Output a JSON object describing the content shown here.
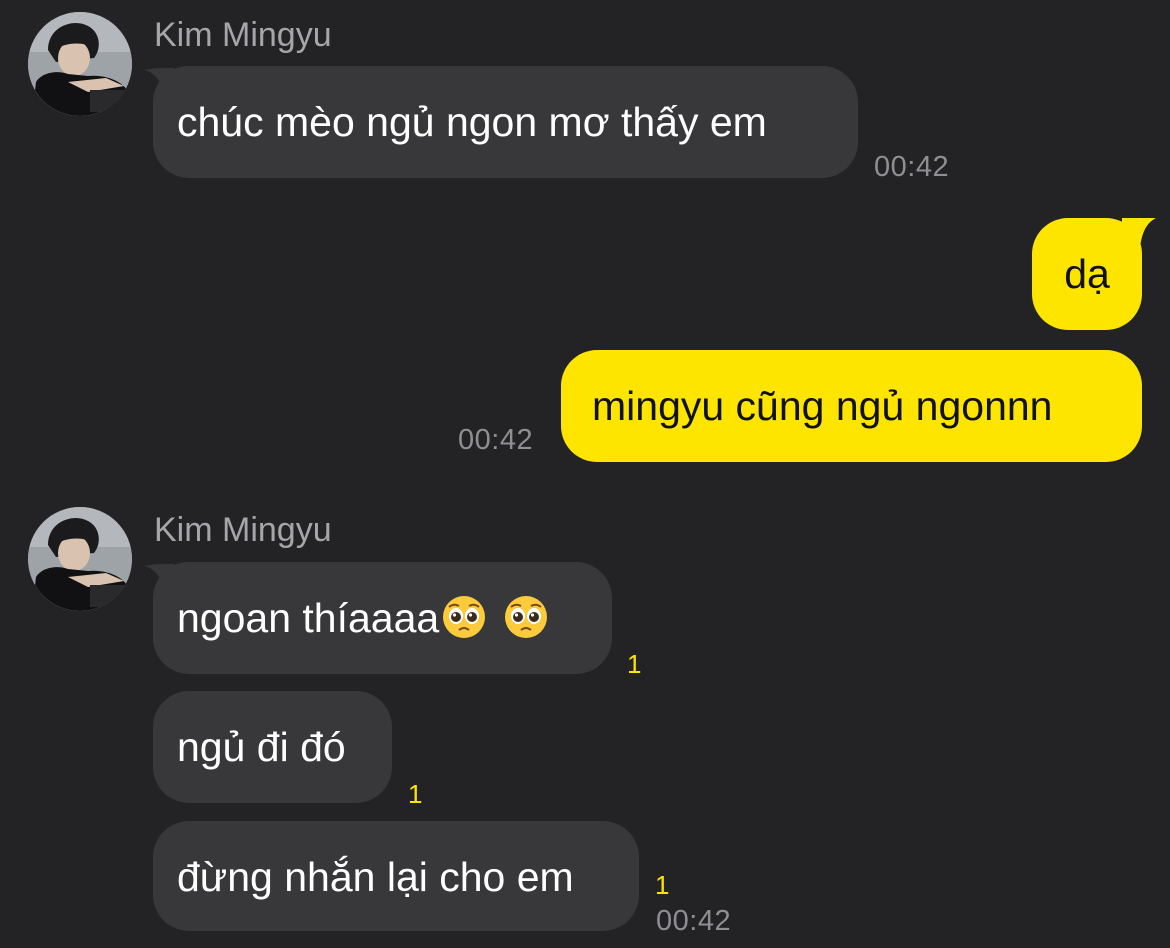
{
  "chat": {
    "groups": [
      {
        "sender": "Kim Mingyu",
        "messages": [
          {
            "text": "chúc mèo ngủ ngon mơ thấy em",
            "time": "00:42"
          }
        ]
      },
      {
        "sender": "me",
        "messages": [
          {
            "text": "dạ"
          },
          {
            "text": "mingyu cũng ngủ ngonnn",
            "time": "00:42"
          }
        ]
      },
      {
        "sender": "Kim Mingyu",
        "messages": [
          {
            "text": "ngoan thíaaaa",
            "emoji": [
              "pleading-face",
              "pleading-face"
            ],
            "unread": "1"
          },
          {
            "text": "ngủ đi đó",
            "unread": "1"
          },
          {
            "text": "đừng nhắn lại cho em",
            "unread": "1",
            "time": "00:42"
          }
        ]
      }
    ]
  },
  "colors": {
    "background": "#232325",
    "incoming_bubble": "#38383b",
    "outgoing_bubble": "#fde500",
    "unread": "#fde500",
    "timestamp": "#8e8e93"
  }
}
